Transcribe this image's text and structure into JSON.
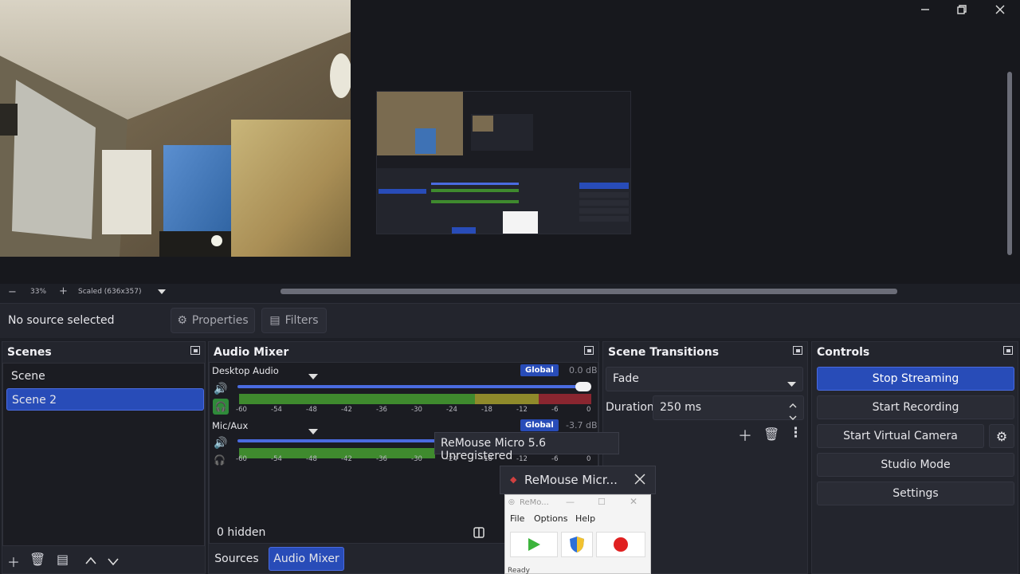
{
  "window": {
    "minimize_icon": "minimize-icon",
    "restore_icon": "restore-icon",
    "close_icon": "close-icon"
  },
  "zoom": {
    "minus": "−",
    "level": "33%",
    "plus": "+",
    "scale_label": "Scaled (636x357)"
  },
  "source_bar": {
    "status": "No source selected",
    "properties_label": "Properties",
    "filters_label": "Filters"
  },
  "scenes": {
    "title": "Scenes",
    "items": [
      {
        "label": "Scene",
        "selected": false
      },
      {
        "label": "Scene 2",
        "selected": true
      }
    ]
  },
  "mixer": {
    "title": "Audio Mixer",
    "channels": [
      {
        "name": "Desktop Audio",
        "badge": "Global",
        "db": "0.0 dB",
        "level": 1.0
      },
      {
        "name": "Mic/Aux",
        "badge": "Global",
        "db": "-3.7 dB",
        "level": 0.55
      }
    ],
    "ticks": [
      "-60",
      "-54",
      "-48",
      "-42",
      "-36",
      "-30",
      "-24",
      "-18",
      "-12",
      "-6",
      "0"
    ],
    "hidden_label": "0 hidden",
    "tabs": [
      "Sources",
      "Audio Mixer"
    ]
  },
  "transitions": {
    "title": "Scene Transitions",
    "selected": "Fade",
    "duration_label": "Duration",
    "duration_value": "250 ms"
  },
  "controls": {
    "title": "Controls",
    "stop_streaming": "Stop Streaming",
    "start_recording": "Start Recording",
    "start_virtual_camera": "Start Virtual Camera",
    "studio_mode": "Studio Mode",
    "settings": "Settings"
  },
  "tooltip": "ReMouse Micro 5.6 Unregistered",
  "remouse": {
    "header_title": "ReMouse Micr...",
    "window_title": "ReMo...",
    "menu": [
      "File",
      "Options",
      "Help"
    ],
    "status": "Ready"
  },
  "colors": {
    "accent": "#284cb8",
    "meter_green": "#3f8a2e",
    "meter_yellow": "#8f8a2b",
    "meter_red": "#8a2630"
  }
}
